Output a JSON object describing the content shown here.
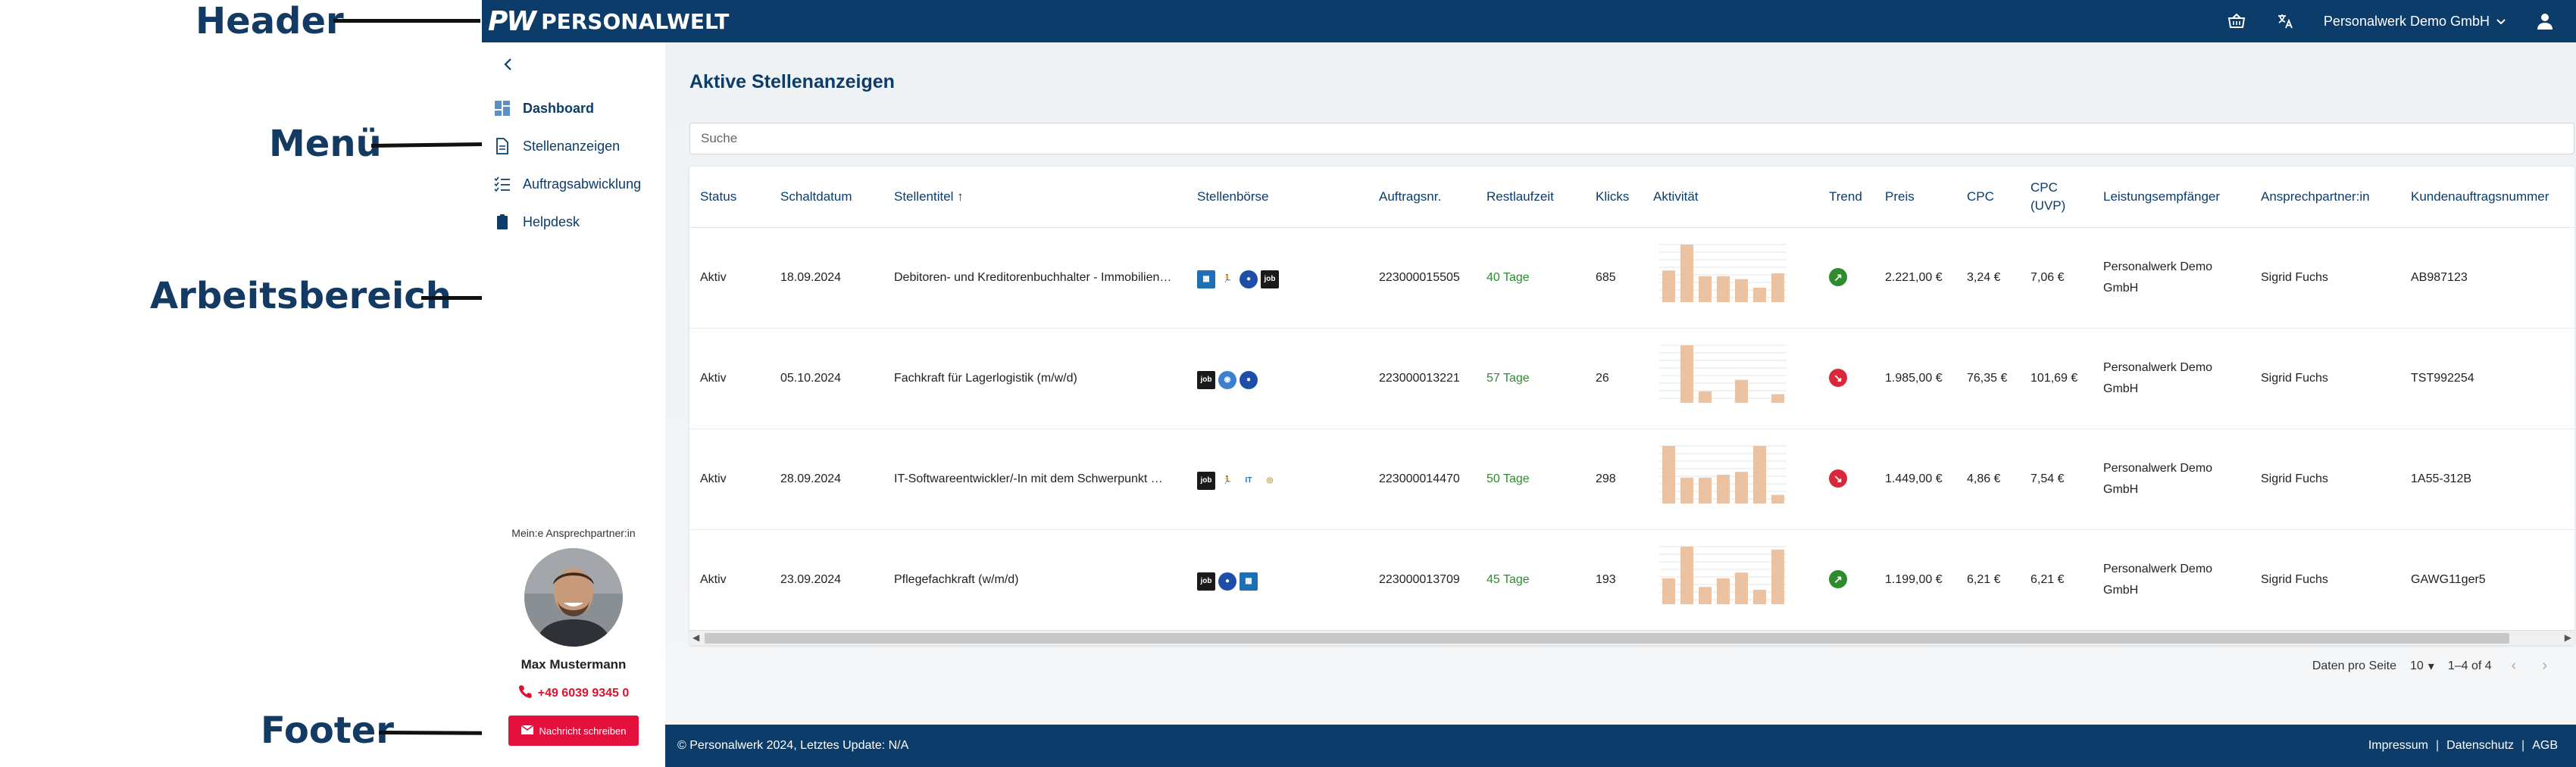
{
  "annotations": {
    "header": "Header",
    "menu": "Menü",
    "workarea": "Arbeitsbereich",
    "footer": "Footer"
  },
  "header": {
    "logo_mark": "PW",
    "logo_text": "PERSONALWELT",
    "company": "Personalwerk Demo GmbH",
    "icons": [
      "cart-icon",
      "translate-icon",
      "chevron-down-icon",
      "user-icon"
    ]
  },
  "sidebar": {
    "items": [
      {
        "label": "Dashboard",
        "icon": "dashboard-icon",
        "active": true
      },
      {
        "label": "Stellenanzeigen",
        "icon": "document-icon",
        "active": false
      },
      {
        "label": "Auftragsabwicklung",
        "icon": "checklist-icon",
        "active": false
      },
      {
        "label": "Helpdesk",
        "icon": "clipboard-icon",
        "active": false
      }
    ],
    "contact": {
      "title": "Mein:e Ansprechpartner:in",
      "name": "Max Mustermann",
      "phone": "+49 6039 9345 0",
      "button": "Nachricht schreiben"
    }
  },
  "main": {
    "title": "Aktive Stellenanzeigen",
    "search_placeholder": "Suche",
    "columns": [
      "Status",
      "Schaltdatum",
      "Stellentitel",
      "Stellenbörse",
      "Auftragsnr.",
      "Restlaufzeit",
      "Klicks",
      "Aktivität",
      "Trend",
      "Preis",
      "CPC",
      "CPC (UVP)",
      "Leistungsempfänger",
      "Ansprechpartner:in",
      "Kundenauftragsnummer"
    ],
    "sort_indicator": "↑",
    "rows": [
      {
        "status": "Aktiv",
        "date": "18.09.2024",
        "title": "Debitoren- und Kreditorenbuchhalter - Immobilien…",
        "boards": [
          "stepstone",
          "indeed",
          "meinestadt",
          "jobware"
        ],
        "order": "223000015505",
        "rest": "40 Tage",
        "clicks": "685",
        "activity": [
          0.55,
          1.0,
          0.45,
          0.45,
          0.4,
          0.25,
          0.5
        ],
        "trend": "up",
        "price": "2.221,00 €",
        "cpc": "3,24 €",
        "cpc_uvp": "7,06 €",
        "recipient_1": "Personalwerk Demo",
        "recipient_2": "GmbH",
        "contact": "Sigrid Fuchs",
        "customer_no": "AB987123"
      },
      {
        "status": "Aktiv",
        "date": "05.10.2024",
        "title": "Fachkraft für Lagerlogistik (m/w/d)",
        "boards": [
          "jobware",
          "xing",
          "meinestadt"
        ],
        "order": "223000013221",
        "rest": "57 Tage",
        "clicks": "26",
        "activity": [
          0.0,
          1.0,
          0.2,
          0.0,
          0.4,
          0.0,
          0.15
        ],
        "trend": "down",
        "price": "1.985,00 €",
        "cpc": "76,35 €",
        "cpc_uvp": "101,69 €",
        "recipient_1": "Personalwerk Demo",
        "recipient_2": "GmbH",
        "contact": "Sigrid Fuchs",
        "customer_no": "TST992254"
      },
      {
        "status": "Aktiv",
        "date": "28.09.2024",
        "title": "IT-Softwareentwickler/-In mit dem Schwerpunkt …",
        "boards": [
          "jobware",
          "indeed",
          "it-jobs",
          "talent"
        ],
        "order": "223000014470",
        "rest": "50 Tage",
        "clicks": "298",
        "activity": [
          1.0,
          0.45,
          0.45,
          0.5,
          0.55,
          1.0,
          0.15
        ],
        "trend": "down",
        "price": "1.449,00 €",
        "cpc": "4,86 €",
        "cpc_uvp": "7,54 €",
        "recipient_1": "Personalwerk Demo",
        "recipient_2": "GmbH",
        "contact": "Sigrid Fuchs",
        "customer_no": "1A55-312B"
      },
      {
        "status": "Aktiv",
        "date": "23.09.2024",
        "title": "Pflegefachkraft (w/m/d)",
        "boards": [
          "jobware",
          "meinestadt",
          "stepstone"
        ],
        "order": "223000013709",
        "rest": "45 Tage",
        "clicks": "193",
        "activity": [
          0.45,
          1.0,
          0.3,
          0.45,
          0.55,
          0.25,
          0.95
        ],
        "trend": "up",
        "price": "1.199,00 €",
        "cpc": "6,21 €",
        "cpc_uvp": "6,21 €",
        "recipient_1": "Personalwerk Demo",
        "recipient_2": "GmbH",
        "contact": "Sigrid Fuchs",
        "customer_no": "GAWG11ger5"
      }
    ],
    "pager": {
      "rows_label": "Daten pro Seite",
      "rows_value": "10",
      "range": "1–4 of 4"
    }
  },
  "footer": {
    "copyright": "© Personalwerk 2024, Letztes Update: N/A",
    "links": [
      "Impressum",
      "Datenschutz",
      "AGB"
    ],
    "separator": "|"
  },
  "colors": {
    "brand": "#0c3c6a",
    "accent": "#e3103c",
    "bar": "#ebc3a3",
    "positive": "#2e8b2e"
  }
}
